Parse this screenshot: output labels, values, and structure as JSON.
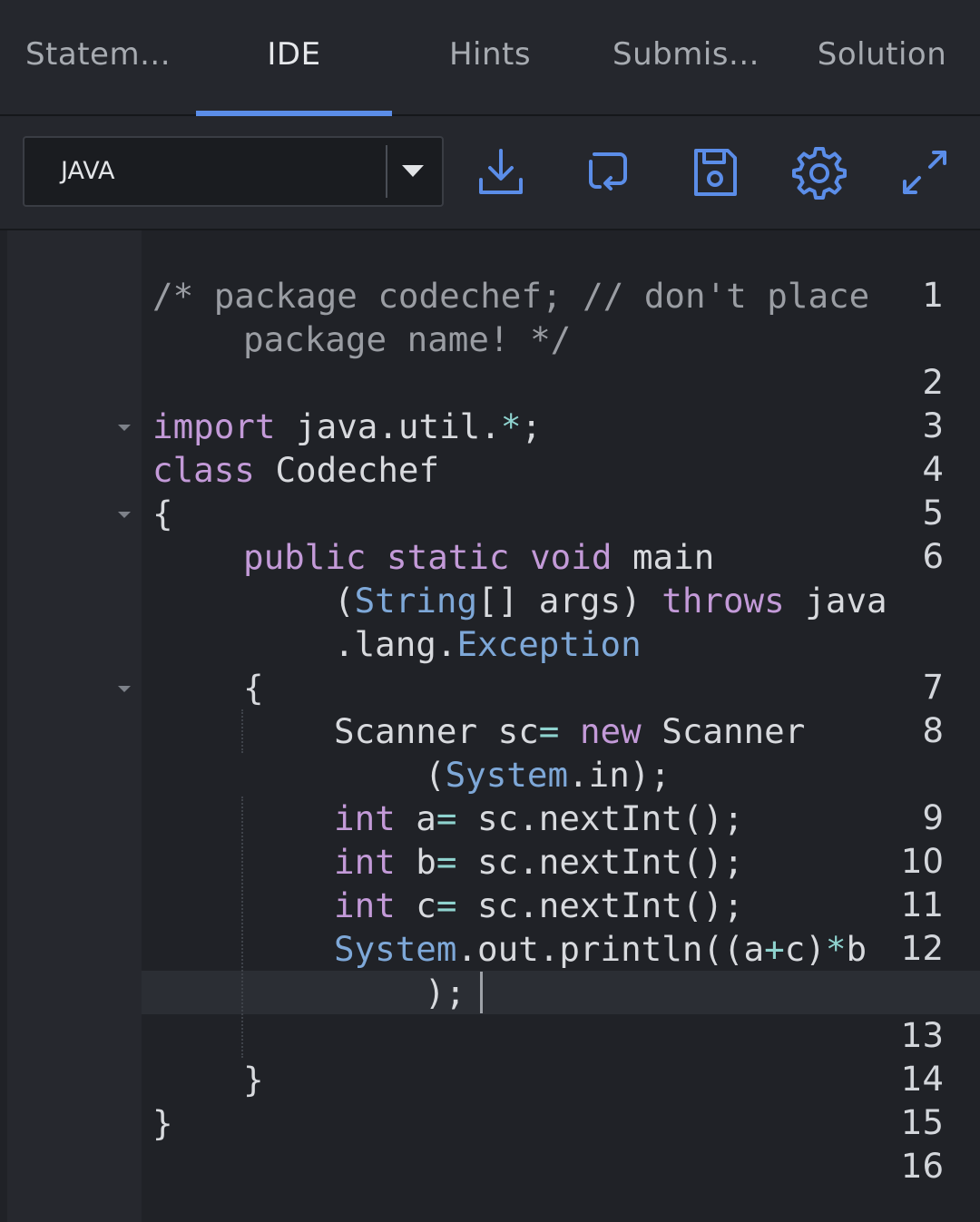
{
  "tabs": [
    {
      "label": "Statem...",
      "active": false
    },
    {
      "label": "IDE",
      "active": true
    },
    {
      "label": "Hints",
      "active": false
    },
    {
      "label": "Submis...",
      "active": false
    },
    {
      "label": "Solution",
      "active": false
    }
  ],
  "toolbar": {
    "language": "JAVA",
    "buttons": [
      "download-icon",
      "reset-icon",
      "save-icon",
      "settings-icon",
      "fullscreen-icon"
    ],
    "accent_color": "#5b8de8"
  },
  "editor": {
    "line_numbers": [
      "1",
      "2",
      "3",
      "4",
      "5",
      "6",
      "7",
      "8",
      "9",
      "10",
      "11",
      "12",
      "13",
      "14",
      "15",
      "16"
    ],
    "active_line": "12",
    "code": {
      "l1a_comment": "/* package codechef; // don't place",
      "l1b_comment": "package name! */",
      "l3_kw": "import",
      "l3_txt": " java.util.",
      "l3_op": "*",
      "l3_end": ";",
      "l4_kw": "class",
      "l4_txt": " Codechef",
      "l5_txt": "{",
      "l6_kw1": "public",
      "l6_kw2": "static",
      "l6_kw3": "void",
      "l6_txt": " main",
      "l6b_p1": "(",
      "l6b_ty": "String",
      "l6b_p2": "[] args) ",
      "l6b_kw": "throws",
      "l6b_p3": " java",
      "l6c_p1": ".lang.",
      "l6c_ty": "Exception",
      "l7_txt": "{",
      "l8_p1": "Scanner sc",
      "l8_op": "=",
      "l8_kw": "new",
      "l8_p2": " Scanner",
      "l8b_p1": "(",
      "l8b_ty": "System",
      "l8b_p2": ".in);",
      "l9_kw": "int",
      "l9_p1": " a",
      "l9_op": "=",
      "l9_p2": " sc.nextInt();",
      "l10_kw": "int",
      "l10_p1": " b",
      "l10_op": "=",
      "l10_p2": " sc.nextInt();",
      "l11_kw": "int",
      "l11_p1": " c",
      "l11_op": "=",
      "l11_p2": " sc.nextInt();",
      "l12_ty": "System",
      "l12_p1": ".out.println((a",
      "l12_op1": "+",
      "l12_p2": "c)",
      "l12_op2": "*",
      "l12_p3": "b",
      "l12b_txt": ");",
      "l14_txt": "}",
      "l15_txt": "}"
    }
  }
}
